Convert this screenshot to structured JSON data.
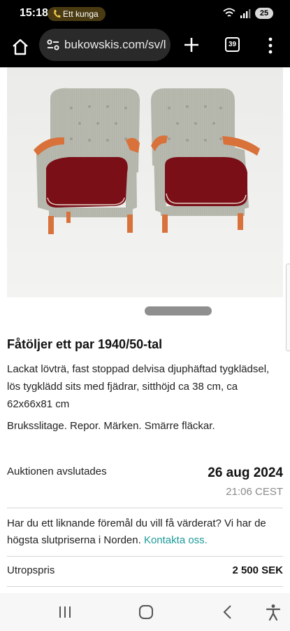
{
  "status": {
    "time": "15:18",
    "call_pill": "Ett kunga",
    "battery": "25"
  },
  "browser": {
    "url": "bukowskis.com/sv/l",
    "tab_count": "39"
  },
  "item": {
    "title": "Fåtöljer ett par 1940/50-tal",
    "description": "Lackat lövträ, fast stoppad delvisa djuphäftad tygklädsel, lös tygklädd sits med fjädrar, sitthöjd ca 38 cm, ca 62x66x81 cm",
    "condition": "Bruksslitage. Repor. Märken. Smärre fläckar."
  },
  "auction": {
    "ends_label": "Auktionen avslutades",
    "end_date": "26 aug 2024",
    "end_time": "21:06 CEST"
  },
  "valuation": {
    "text": "Har du ett liknande föremål du vill få värderat? Vi har de högsta slutpriserna i Norden.",
    "link": "Kontakta oss."
  },
  "pricing": {
    "label": "Utropspris",
    "value": "2 500 SEK"
  },
  "colors": {
    "link": "#1f9a9a",
    "upholstery_grey": "#b5b7ad",
    "seat_red": "#7a0f18",
    "wood": "#d8723a"
  }
}
